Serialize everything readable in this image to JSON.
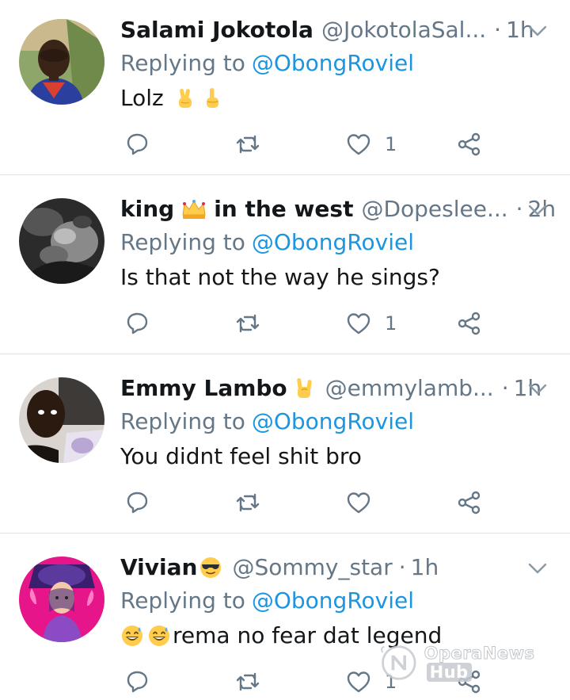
{
  "colors": {
    "name": "#14171a",
    "secondary": "#657786",
    "link": "#1b95e0",
    "divider": "#dfe3e6"
  },
  "watermark": {
    "text": "OperaNews",
    "hub": "Hub"
  },
  "tweets": [
    {
      "name": "Salami Jokotola",
      "handle": "@JokotolaSal...",
      "time": "1h",
      "reply_prefix": "Replying to",
      "reply_to": "@ObongRoviel",
      "text": "Lolz",
      "text_emojis": [
        "victory-hand",
        "index-pointing-up"
      ],
      "name_emoji": "",
      "likes": "1"
    },
    {
      "name_part1": "king",
      "name_part2": "in the west",
      "name_emoji": "crown",
      "handle": "@Dopeslee...",
      "time": "2h",
      "reply_prefix": "Replying to",
      "reply_to": "@ObongRoviel",
      "text": "Is that not the way he sings?",
      "likes": "1"
    },
    {
      "name": "Emmy Lambo",
      "name_emoji": "sign-of-horns",
      "handle": "@emmylamb...",
      "time": "1h",
      "reply_prefix": "Replying to",
      "reply_to": "@ObongRoviel",
      "text": "You didnt feel shit bro",
      "likes": ""
    },
    {
      "name": "Vivian",
      "name_emoji": "sunglasses-face",
      "handle": "@Sommy_star",
      "time": "1h",
      "reply_prefix": "Replying to",
      "reply_to": "@ObongRoviel",
      "text": "rema no fear dat legend",
      "text_emojis": [
        "sweat-smile-face",
        "sweat-smile-face"
      ],
      "likes": "1"
    }
  ]
}
